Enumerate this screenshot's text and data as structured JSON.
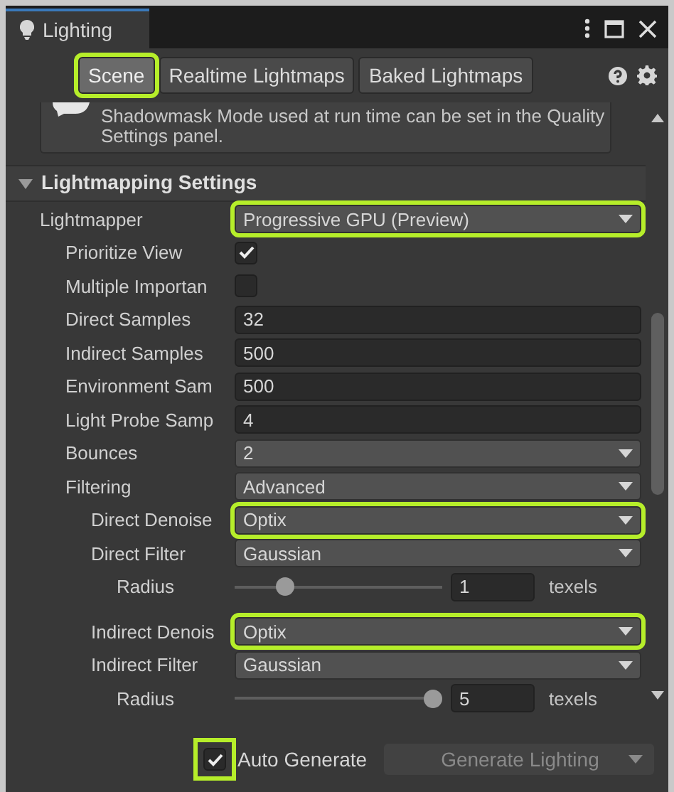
{
  "window": {
    "title": "Lighting"
  },
  "tabs": [
    {
      "label": "Scene",
      "selected": true,
      "highlighted": true
    },
    {
      "label": "Realtime Lightmaps",
      "selected": false,
      "highlighted": false
    },
    {
      "label": "Baked Lightmaps",
      "selected": false,
      "highlighted": false
    }
  ],
  "help_box": {
    "text": "Shadowmask Mode used at run time can be set in the Quality Settings panel."
  },
  "section": {
    "title": "Lightmapping Settings",
    "expanded": true
  },
  "settings": [
    {
      "kind": "dropdown",
      "label": "Lightmapper",
      "value": "Progressive GPU (Preview)",
      "highlighted": true,
      "children": [
        {
          "kind": "checkbox",
          "label": "Prioritize View",
          "checked": true
        },
        {
          "kind": "checkbox",
          "label": "Multiple Importan",
          "checked": false
        },
        {
          "kind": "number",
          "label": "Direct Samples",
          "value": "32"
        },
        {
          "kind": "number",
          "label": "Indirect Samples",
          "value": "500"
        },
        {
          "kind": "number",
          "label": "Environment Sam",
          "value": "500"
        },
        {
          "kind": "number",
          "label": "Light Probe Samp",
          "value": "4"
        },
        {
          "kind": "dropdown",
          "label": "Bounces",
          "value": "2",
          "highlighted": false
        },
        {
          "kind": "dropdown",
          "label": "Filtering",
          "value": "Advanced",
          "highlighted": false,
          "children": [
            {
              "kind": "dropdown",
              "label": "Direct Denoise",
              "value": "Optix",
              "highlighted": true
            },
            {
              "kind": "dropdown",
              "label": "Direct Filter",
              "value": "Gaussian",
              "highlighted": false,
              "children": [
                {
                  "kind": "slider",
                  "label": "Radius",
                  "level": 0.22,
                  "value": "1",
                  "unit": "texels"
                }
              ]
            },
            {
              "kind": "dropdown",
              "label": "Indirect Denois",
              "value": "Optix",
              "highlighted": true
            },
            {
              "kind": "dropdown",
              "label": "Indirect Filter",
              "value": "Gaussian",
              "highlighted": false,
              "children": [
                {
                  "kind": "slider",
                  "label": "Radius",
                  "level": 1,
                  "value": "5",
                  "unit": "texels"
                }
              ]
            }
          ]
        }
      ]
    }
  ],
  "footer": {
    "auto_generate": {
      "label": "Auto Generate",
      "checked": true,
      "highlighted": true
    },
    "generate_button": {
      "label": "Generate Lighting",
      "disabled": true
    }
  }
}
